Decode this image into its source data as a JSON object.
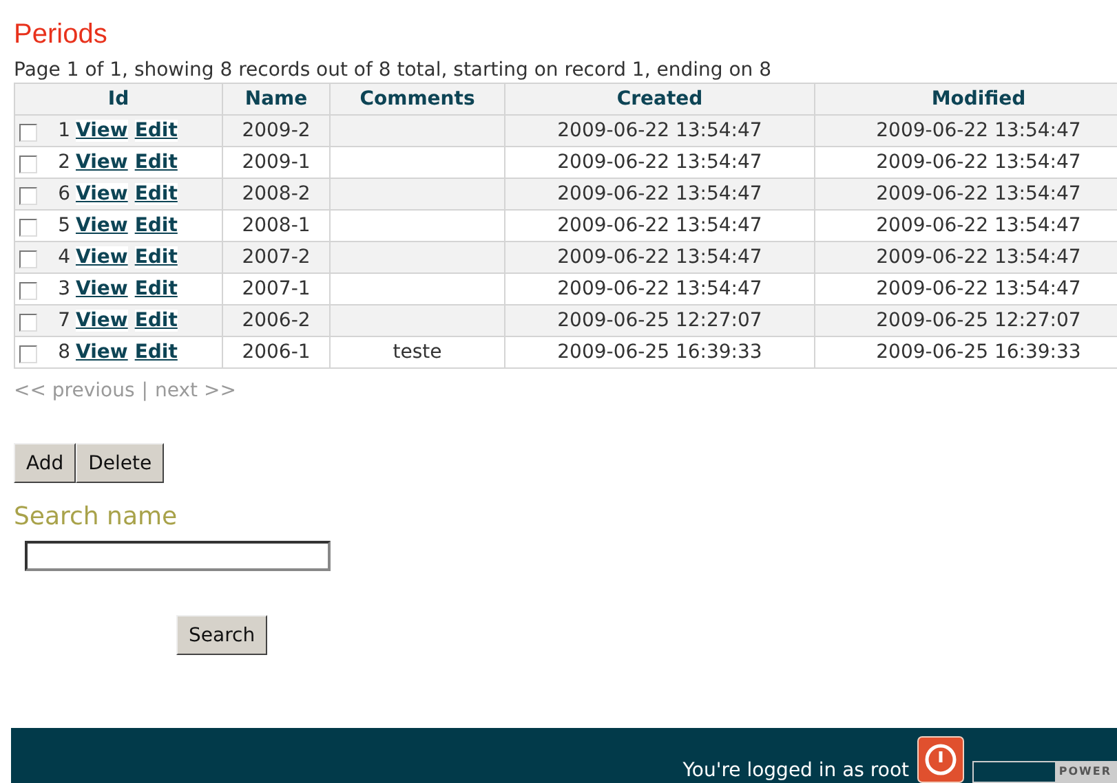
{
  "title": "Periods",
  "summary": "Page 1 of 1, showing 8 records out of 8 total, starting on record 1, ending on 8",
  "table": {
    "columns": [
      "Id",
      "Name",
      "Comments",
      "Created",
      "Modified"
    ],
    "rows": [
      {
        "checked": false,
        "id": "1",
        "view": "View",
        "edit": "Edit",
        "name": "2009-2",
        "comments": "",
        "created": "2009-06-22 13:54:47",
        "modified": "2009-06-22 13:54:47"
      },
      {
        "checked": false,
        "id": "2",
        "view": "View",
        "edit": "Edit",
        "name": "2009-1",
        "comments": "",
        "created": "2009-06-22 13:54:47",
        "modified": "2009-06-22 13:54:47"
      },
      {
        "checked": false,
        "id": "6",
        "view": "View",
        "edit": "Edit",
        "name": "2008-2",
        "comments": "",
        "created": "2009-06-22 13:54:47",
        "modified": "2009-06-22 13:54:47"
      },
      {
        "checked": false,
        "id": "5",
        "view": "View",
        "edit": "Edit",
        "name": "2008-1",
        "comments": "",
        "created": "2009-06-22 13:54:47",
        "modified": "2009-06-22 13:54:47"
      },
      {
        "checked": false,
        "id": "4",
        "view": "View",
        "edit": "Edit",
        "name": "2007-2",
        "comments": "",
        "created": "2009-06-22 13:54:47",
        "modified": "2009-06-22 13:54:47"
      },
      {
        "checked": false,
        "id": "3",
        "view": "View",
        "edit": "Edit",
        "name": "2007-1",
        "comments": "",
        "created": "2009-06-22 13:54:47",
        "modified": "2009-06-22 13:54:47"
      },
      {
        "checked": false,
        "id": "7",
        "view": "View",
        "edit": "Edit",
        "name": "2006-2",
        "comments": "",
        "created": "2009-06-25 12:27:07",
        "modified": "2009-06-25 12:27:07"
      },
      {
        "checked": false,
        "id": "8",
        "view": "View",
        "edit": "Edit",
        "name": "2006-1",
        "comments": "teste",
        "created": "2009-06-25 16:39:33",
        "modified": "2009-06-25 16:39:33"
      }
    ]
  },
  "pagination": {
    "previous": {
      "label": "<< previous",
      "disabled": true
    },
    "separator": "|",
    "next": {
      "label": "next >>",
      "disabled": true
    }
  },
  "buttons": [
    "Add",
    "Delete"
  ],
  "search": {
    "label": "Search name",
    "button": "Search"
  },
  "footer": {
    "text": "You're logged in as root",
    "badge": "POWER"
  }
}
